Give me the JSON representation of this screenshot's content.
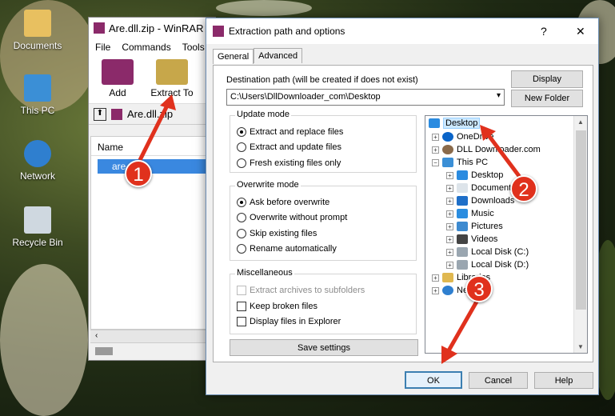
{
  "desktop": {
    "icons": [
      {
        "label": "Documents"
      },
      {
        "label": "This PC"
      },
      {
        "label": "Network"
      },
      {
        "label": "Recycle Bin"
      }
    ]
  },
  "winrar": {
    "title": "Are.dll.zip - WinRAR",
    "menu": [
      "File",
      "Commands",
      "Tools"
    ],
    "toolbar": {
      "add": "Add",
      "extract_to": "Extract To"
    },
    "path": "Are.dll.zip",
    "list_header": "Name",
    "selected_file": "are.dll"
  },
  "dialog": {
    "title": "Extraction path and options",
    "help_icon": "?",
    "close_icon": "✕",
    "tabs": {
      "general": "General",
      "advanced": "Advanced"
    },
    "dest_label": "Destination path (will be created if does not exist)",
    "dest_value": "C:\\Users\\DllDownloader_com\\Desktop",
    "display_btn": "Display",
    "new_folder_btn": "New Folder",
    "update_mode": {
      "title": "Update mode",
      "options": [
        "Extract and replace files",
        "Extract and update files",
        "Fresh existing files only"
      ],
      "selected": 0
    },
    "overwrite_mode": {
      "title": "Overwrite mode",
      "options": [
        "Ask before overwrite",
        "Overwrite without prompt",
        "Skip existing files",
        "Rename automatically"
      ],
      "selected": 0
    },
    "misc": {
      "title": "Miscellaneous",
      "extract_subfolders": "Extract archives to subfolders",
      "keep_broken": "Keep broken files",
      "display_explorer": "Display files in Explorer"
    },
    "save_settings": "Save settings",
    "tree": {
      "desktop": "Desktop",
      "onedrive": "OneDrive",
      "dlldownloader": "DLL Downloader.com",
      "thispc": "This PC",
      "pc_desktop": "Desktop",
      "documents": "Documents",
      "downloads": "Downloads",
      "music": "Music",
      "pictures": "Pictures",
      "videos": "Videos",
      "local_c": "Local Disk (C:)",
      "local_d": "Local Disk (D:)",
      "libraries": "Libraries",
      "network": "Network"
    },
    "ok": "OK",
    "cancel": "Cancel",
    "help": "Help"
  },
  "markers": [
    "1",
    "2",
    "3"
  ]
}
